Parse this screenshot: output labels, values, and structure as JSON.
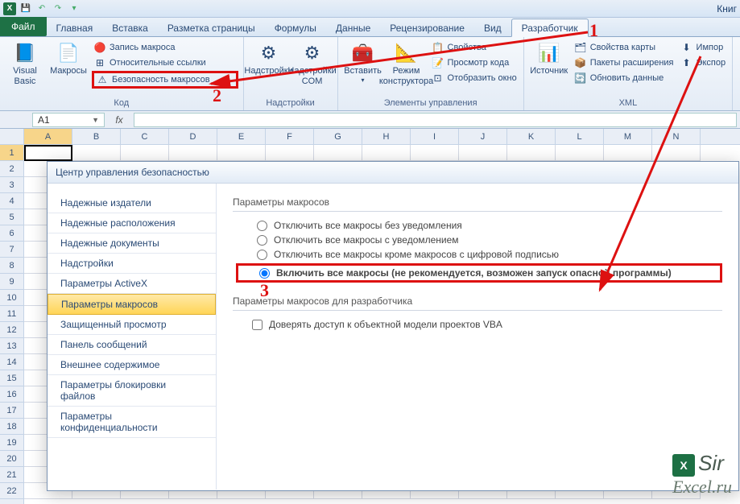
{
  "titlebar": {
    "title": "Книг"
  },
  "tabs": {
    "file": "Файл",
    "items": [
      "Главная",
      "Вставка",
      "Разметка страницы",
      "Формулы",
      "Данные",
      "Рецензирование",
      "Вид",
      "Разработчик"
    ],
    "activeIndex": 7
  },
  "ribbon": {
    "code": {
      "vb": "Visual\nBasic",
      "macros": "Макросы",
      "record": "Запись макроса",
      "relref": "Относительные ссылки",
      "macsec": "Безопасность макросов",
      "label": "Код"
    },
    "addins": {
      "addins": "Надстройки",
      "com": "Надстройки\nCOM",
      "label": "Надстройки"
    },
    "controls": {
      "insert": "Вставить",
      "design": "Режим\nконструктора",
      "props": "Свойства",
      "viewcode": "Просмотр кода",
      "showwin": "Отобразить окно",
      "label": "Элементы управления"
    },
    "xml": {
      "source": "Источник",
      "mapprops": "Свойства карты",
      "exppacks": "Пакеты расширения",
      "refresh": "Обновить данные",
      "import": "Импор",
      "export": "Экспор",
      "label": "XML"
    }
  },
  "namebox": "A1",
  "cols": [
    "A",
    "B",
    "C",
    "D",
    "E",
    "F",
    "G",
    "H",
    "I",
    "J",
    "K",
    "L",
    "M",
    "N"
  ],
  "rows": [
    "1",
    "2",
    "3",
    "4",
    "5",
    "6",
    "7",
    "8",
    "9",
    "10",
    "11",
    "12",
    "13",
    "14",
    "15",
    "16",
    "17",
    "18",
    "19",
    "20",
    "21",
    "22"
  ],
  "dialog": {
    "title": "Центр управления безопасностью",
    "nav": [
      "Надежные издатели",
      "Надежные расположения",
      "Надежные документы",
      "Надстройки",
      "Параметры ActiveX",
      "Параметры макросов",
      "Защищенный просмотр",
      "Панель сообщений",
      "Внешнее содержимое",
      "Параметры блокировки файлов",
      "Параметры конфиденциальности"
    ],
    "navSelected": 5,
    "sec1": "Параметры макросов",
    "opts": [
      "Отключить все макросы без уведомления",
      "Отключить все макросы с уведомлением",
      "Отключить все макросы кроме макросов с цифровой подписью",
      "Включить все макросы (не рекомендуется, возможен запуск опасной программы)"
    ],
    "sec2": "Параметры макросов для разработчика",
    "cb": "Доверять доступ к объектной модели проектов VBA"
  },
  "anno": {
    "a1": "1",
    "a2": "2",
    "a3": "3"
  },
  "wm": {
    "l1": "Sir",
    "l2": "Excel.ru"
  }
}
